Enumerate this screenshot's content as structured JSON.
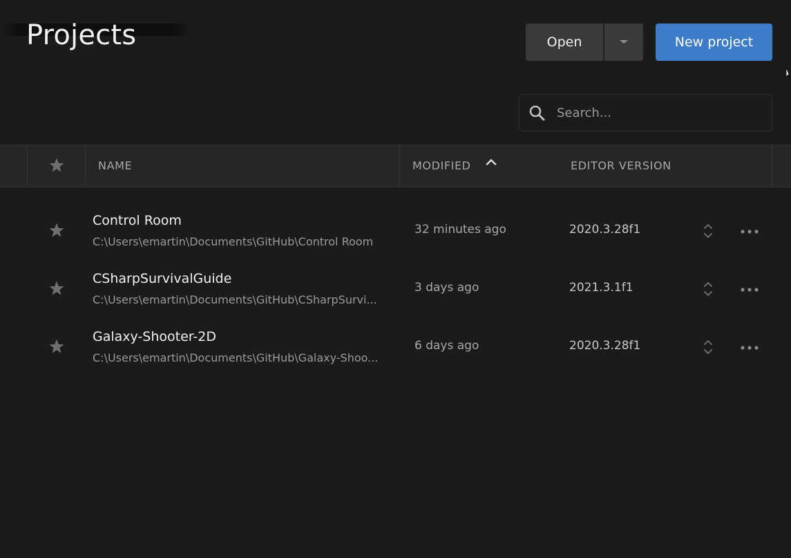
{
  "header": {
    "title": "Projects",
    "open_button": "Open",
    "new_project_button": "New project"
  },
  "search": {
    "placeholder": "Search..."
  },
  "table": {
    "columns": {
      "name": "NAME",
      "modified": "MODIFIED",
      "editor_version": "EDITOR VERSION"
    },
    "sort": {
      "column": "modified",
      "direction": "ascending"
    },
    "rows": [
      {
        "name": "Control Room",
        "path": "C:\\Users\\emartin\\Documents\\GitHub\\Control Room",
        "modified": "32 minutes ago",
        "editor_version": "2020.3.28f1"
      },
      {
        "name": "CSharpSurvivalGuide",
        "path": "C:\\Users\\emartin\\Documents\\GitHub\\CSharpSurvi...",
        "modified": "3 days ago",
        "editor_version": "2021.3.1f1"
      },
      {
        "name": "Galaxy-Shooter-2D",
        "path": "C:\\Users\\emartin\\Documents\\GitHub\\Galaxy-Shoo...",
        "modified": "6 days ago",
        "editor_version": "2020.3.28f1"
      }
    ]
  },
  "colors": {
    "background": "#1b1b1b",
    "accent": "#3d7cc7",
    "header_row": "#262626",
    "button_secondary": "#3b3a39"
  },
  "icons": {
    "star": "star-icon",
    "search": "search-icon",
    "dropdown": "chevron-down-icon",
    "sort": "chevron-up-icon",
    "version_select": "up-down-chevron-icon",
    "more": "more-dots-icon"
  }
}
